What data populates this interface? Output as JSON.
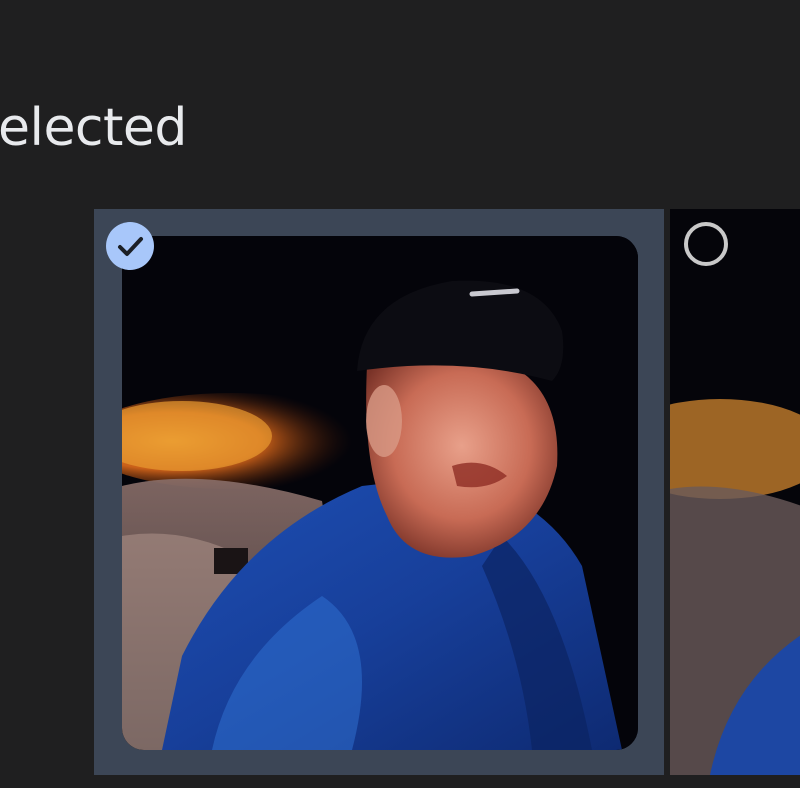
{
  "header": {
    "title_fragment": "elected"
  },
  "gallery": {
    "items": [
      {
        "selected": true,
        "icon": "checkmark-icon",
        "photo": "man-in-cap-and-blue-jacket"
      },
      {
        "selected": false,
        "icon": "empty-circle-icon",
        "photo": "man-in-cap-and-blue-jacket"
      }
    ]
  },
  "colors": {
    "background": "#1f1f20",
    "selected_tile": "#3c4656",
    "check_accent": "#a8c7fa",
    "text": "#e8eaed"
  }
}
